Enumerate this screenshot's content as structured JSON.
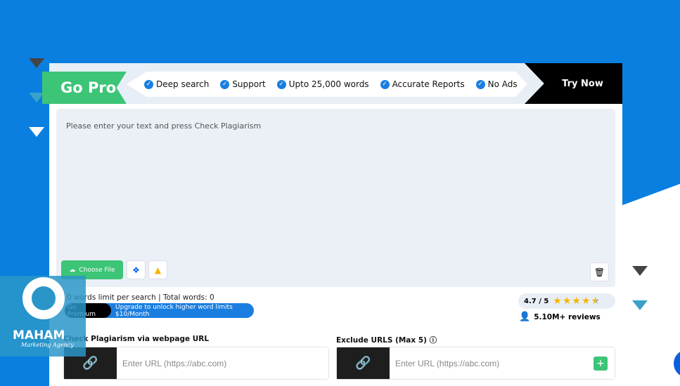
{
  "banner": {
    "go_pro": "Go Pro",
    "features": [
      "Deep search",
      "Support",
      "Upto 25,000 words",
      "Accurate Reports",
      "No Ads"
    ],
    "try_now": "Try Now"
  },
  "editor": {
    "placeholder": "Please enter your text and press Check Plagiarism",
    "choose_file": "Choose File",
    "dropbox_icon": "dropbox-icon",
    "drive_icon": "google-drive-icon",
    "delete_icon": "trash-icon"
  },
  "limits": {
    "text": "0 words limit per search | Total words: 0",
    "go_premium": "Go Premium",
    "upgrade": "Upgrade to unlock higher word limits $10/Month"
  },
  "rating": {
    "score": "4.7 / 5",
    "stars": 4.7,
    "reviews": "5.10M+ reviews"
  },
  "url_check": {
    "label": "Check Plagiarism via webpage URL",
    "placeholder": "Enter URL (https://abc.com)"
  },
  "exclude": {
    "label": "Exclude URLS (Max 5)",
    "placeholder": "Enter URL (https://abc.com)"
  },
  "logo": {
    "name": "MAHAM",
    "tagline": "Marketing Agency"
  },
  "colors": {
    "blue": "#0a7fe0",
    "green": "#3cc477",
    "star": "#f8b400"
  }
}
